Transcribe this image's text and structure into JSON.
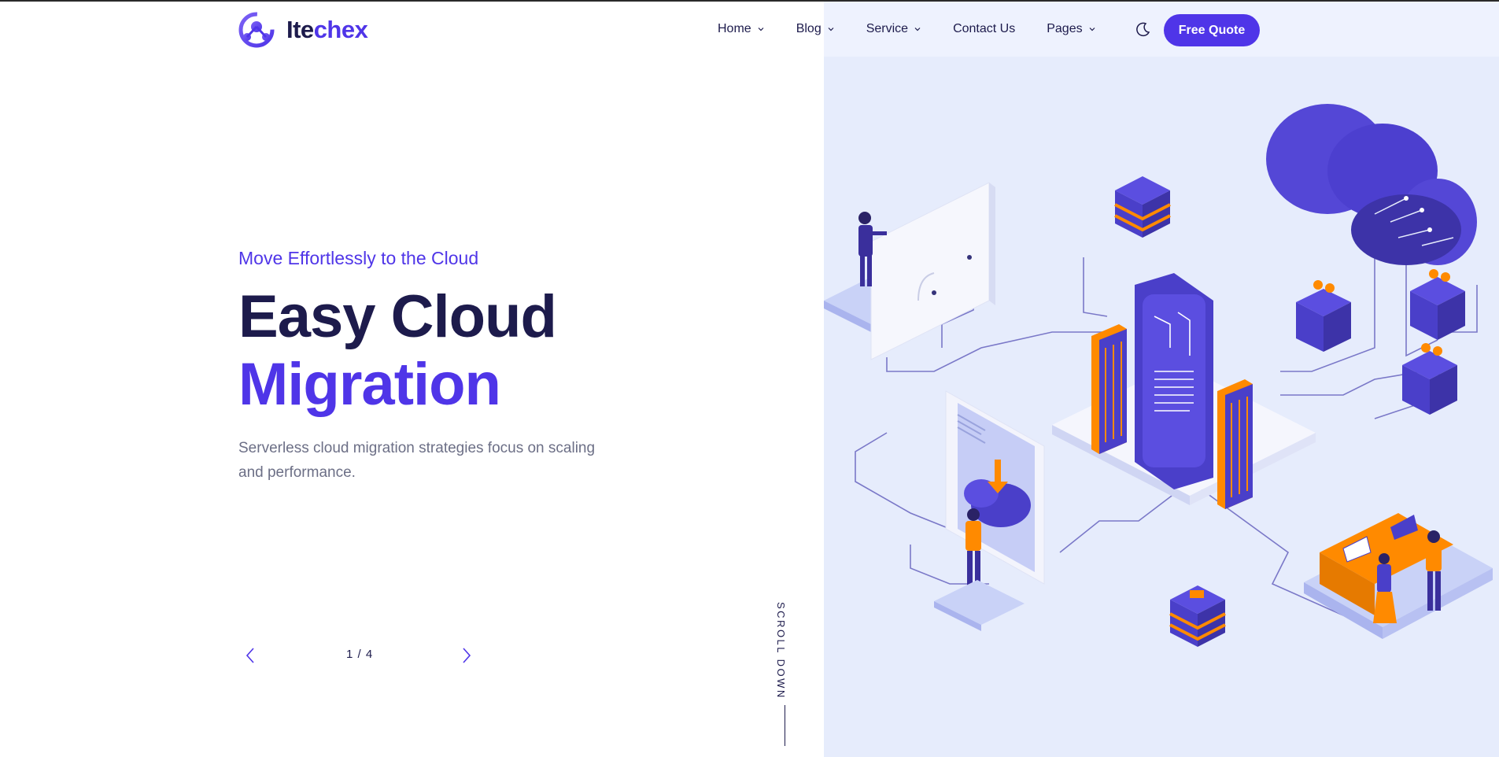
{
  "brand": {
    "name_part1": "Ite",
    "name_part2": "chex",
    "logo_icon": "network-molecule-logo",
    "accent_color": "#4f35e8",
    "dark_color": "#1d1b4c"
  },
  "nav": {
    "items": [
      {
        "label": "Home",
        "has_dropdown": true
      },
      {
        "label": "Blog",
        "has_dropdown": true
      },
      {
        "label": "Service",
        "has_dropdown": true
      },
      {
        "label": "Contact Us",
        "has_dropdown": false
      },
      {
        "label": "Pages",
        "has_dropdown": true
      }
    ],
    "theme_icon": "moon-icon",
    "cta_label": "Free Quote"
  },
  "hero": {
    "eyebrow": "Move Effortlessly to the Cloud",
    "title_line1": "Easy Cloud",
    "title_line2": "Migration",
    "description": "Serverless cloud migration strategies focus on scaling and performance."
  },
  "slider": {
    "prev_icon": "chevron-left-icon",
    "next_icon": "chevron-right-icon",
    "pager": "1 / 4"
  },
  "scroll": {
    "label": "SCROLL DOWN"
  },
  "illustration": {
    "panel_color": "#e6ecfc",
    "orange": "#ff8a00",
    "purple": "#4f35e8"
  }
}
